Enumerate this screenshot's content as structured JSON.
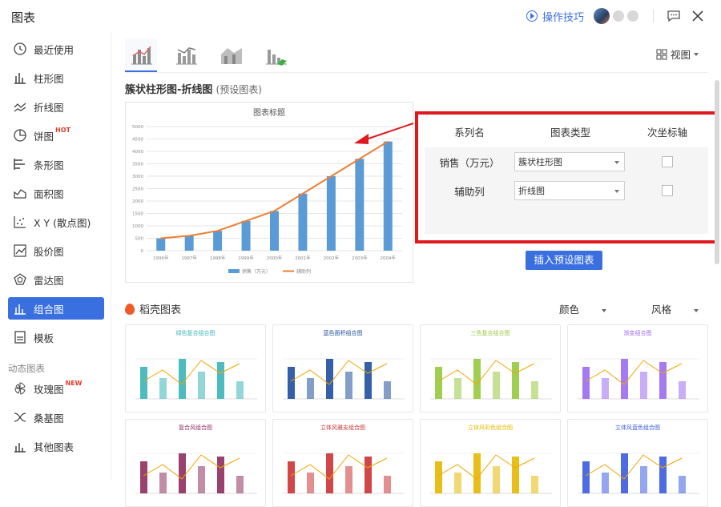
{
  "app": {
    "title": "图表"
  },
  "titlebar": {
    "tips_label": "操作技巧"
  },
  "sidebar": {
    "items": [
      {
        "label": "最近使用",
        "icon": "clock-icon"
      },
      {
        "label": "柱形图",
        "icon": "column-chart-icon"
      },
      {
        "label": "折线图",
        "icon": "line-chart-icon"
      },
      {
        "label": "饼图",
        "icon": "pie-chart-icon",
        "tag": "HOT"
      },
      {
        "label": "条形图",
        "icon": "bar-chart-icon"
      },
      {
        "label": "面积图",
        "icon": "area-chart-icon"
      },
      {
        "label": "X Y (散点图)",
        "icon": "scatter-chart-icon"
      },
      {
        "label": "股价图",
        "icon": "stock-chart-icon"
      },
      {
        "label": "雷达图",
        "icon": "radar-chart-icon"
      },
      {
        "label": "组合图",
        "icon": "combo-chart-icon",
        "active": true
      },
      {
        "label": "模板",
        "icon": "template-icon"
      }
    ],
    "group_label": "动态图表",
    "dynamic_items": [
      {
        "label": "玫瑰图",
        "icon": "rose-chart-icon",
        "tag": "NEW"
      },
      {
        "label": "桑基图",
        "icon": "sankey-chart-icon"
      },
      {
        "label": "其他图表",
        "icon": "other-chart-icon"
      }
    ]
  },
  "main": {
    "view_label": "视图",
    "chart_name": "簇状柱形图-折线图",
    "chart_name_suffix": "(预设图表)",
    "config": {
      "headers": [
        "系列名",
        "图表类型",
        "次坐标轴"
      ],
      "rows": [
        {
          "name": "销售（万元）",
          "type": "簇状柱形图",
          "secondary_axis": false
        },
        {
          "name": "辅助列",
          "type": "折线图",
          "secondary_axis": false
        }
      ]
    },
    "insert_button": "插入预设图表",
    "section_title": "稻壳图表",
    "filter_color": "颜色",
    "filter_style": "风格",
    "thumbnails": [
      {
        "title": "绿色复合组合图",
        "color": "#3bb4b8"
      },
      {
        "title": "蓝色面积组合图",
        "color": "#1f4e9e"
      },
      {
        "title": "三色复合组合图",
        "color": "#95c93d"
      },
      {
        "title": "渐变组合图",
        "color": "#9b6cf0"
      },
      {
        "title": "复合风组合图",
        "color": "#8f2d5d"
      },
      {
        "title": "立体风雅支组合图",
        "color": "#c33"
      },
      {
        "title": "立体风彩色组合图",
        "color": "#e6b800"
      },
      {
        "title": "立体风蓝色组合图",
        "color": "#3a5ce0"
      }
    ]
  },
  "chart_data": {
    "type": "bar",
    "title": "图表标题",
    "categories": [
      "1996年",
      "1997年",
      "1998年",
      "1999年",
      "2000年",
      "2001年",
      "2002年",
      "2003年",
      "2004年"
    ],
    "series": [
      {
        "name": "销售（万元）",
        "type": "bar",
        "color": "#5b9bd5",
        "values": [
          500,
          600,
          800,
          1200,
          1600,
          2300,
          3000,
          3700,
          4400
        ]
      },
      {
        "name": "辅助列",
        "type": "line",
        "color": "#ed7d31",
        "values": [
          500,
          600,
          800,
          1200,
          1600,
          2300,
          3000,
          3700,
          4400
        ]
      }
    ],
    "ylim": [
      0,
      5000
    ],
    "yticks": [
      0,
      500,
      1000,
      1500,
      2000,
      2500,
      3000,
      3500,
      4000,
      4500,
      5000
    ],
    "legend": "bottom",
    "grid": true
  }
}
